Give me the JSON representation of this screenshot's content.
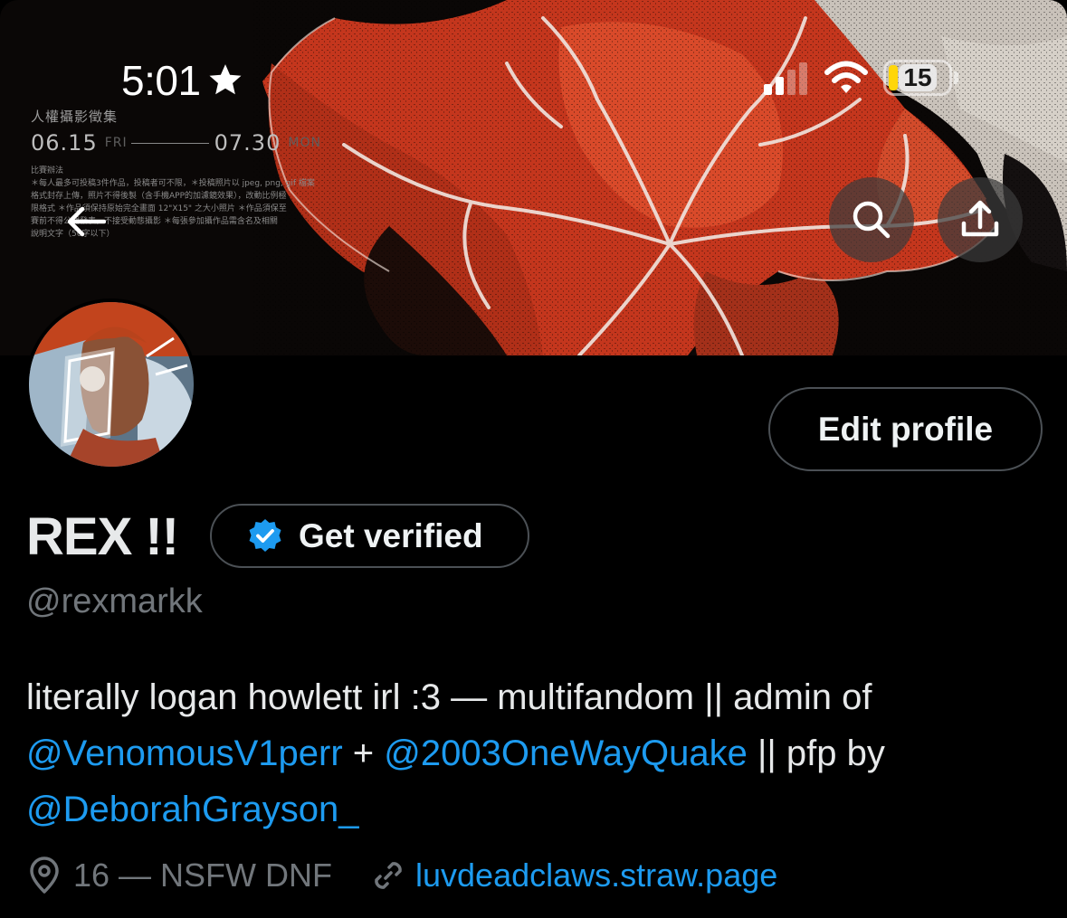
{
  "status_bar": {
    "time": "5:01",
    "battery_level": "15",
    "battery_fraction": 0.15
  },
  "banner": {
    "poster_title": "人權攝影徵集",
    "date_start": "06.15",
    "date_start_dow": "FRI",
    "date_end": "07.30",
    "date_end_dow": "MON",
    "small_heading": "比賽辦法",
    "small_lines": [
      "＊每人最多可投稿3件作品，投稿者可不限，＊投稿照片以 jpeg, png, gif 檔案",
      "格式封存上傳，照片不得後製（含手機APP的加濾鏡效果），改動比例極",
      "限格式 ＊作品須保持原始完全畫面 12\"X15\" 之大小照片 ＊作品須保至",
      "賽前不得公開發表，不接受動態攝影 ＊每張參加攝作品需含名及相關",
      "說明文字（50字以下）"
    ]
  },
  "profile": {
    "display_name": "REX !!",
    "verified_label": "Get verified",
    "handle": "@rexmarkk",
    "edit_label": "Edit profile",
    "bio": {
      "text1": "literally logan howlett irl :3 — multifandom || admin of",
      "mention1": "@VenomousV1perr",
      "text2": " + ",
      "mention2": "@2003OneWayQuake",
      "text3": " || pfp by",
      "mention3": "@DeborahGrayson_"
    },
    "location": "16 — NSFW DNF",
    "website": "luvdeadclaws.straw.page"
  },
  "icons": {
    "back": "arrow-left-icon",
    "search": "search-icon",
    "share": "share-icon",
    "verified": "verified-badge-icon",
    "location": "location-pin-icon",
    "link": "link-icon",
    "star": "star-icon"
  },
  "colors": {
    "accent": "#1d9bf0",
    "background": "#000000",
    "text_primary": "#e7e9ea",
    "text_secondary": "#71767b",
    "border": "#4b5055",
    "battery_low": "#ffd60a"
  }
}
